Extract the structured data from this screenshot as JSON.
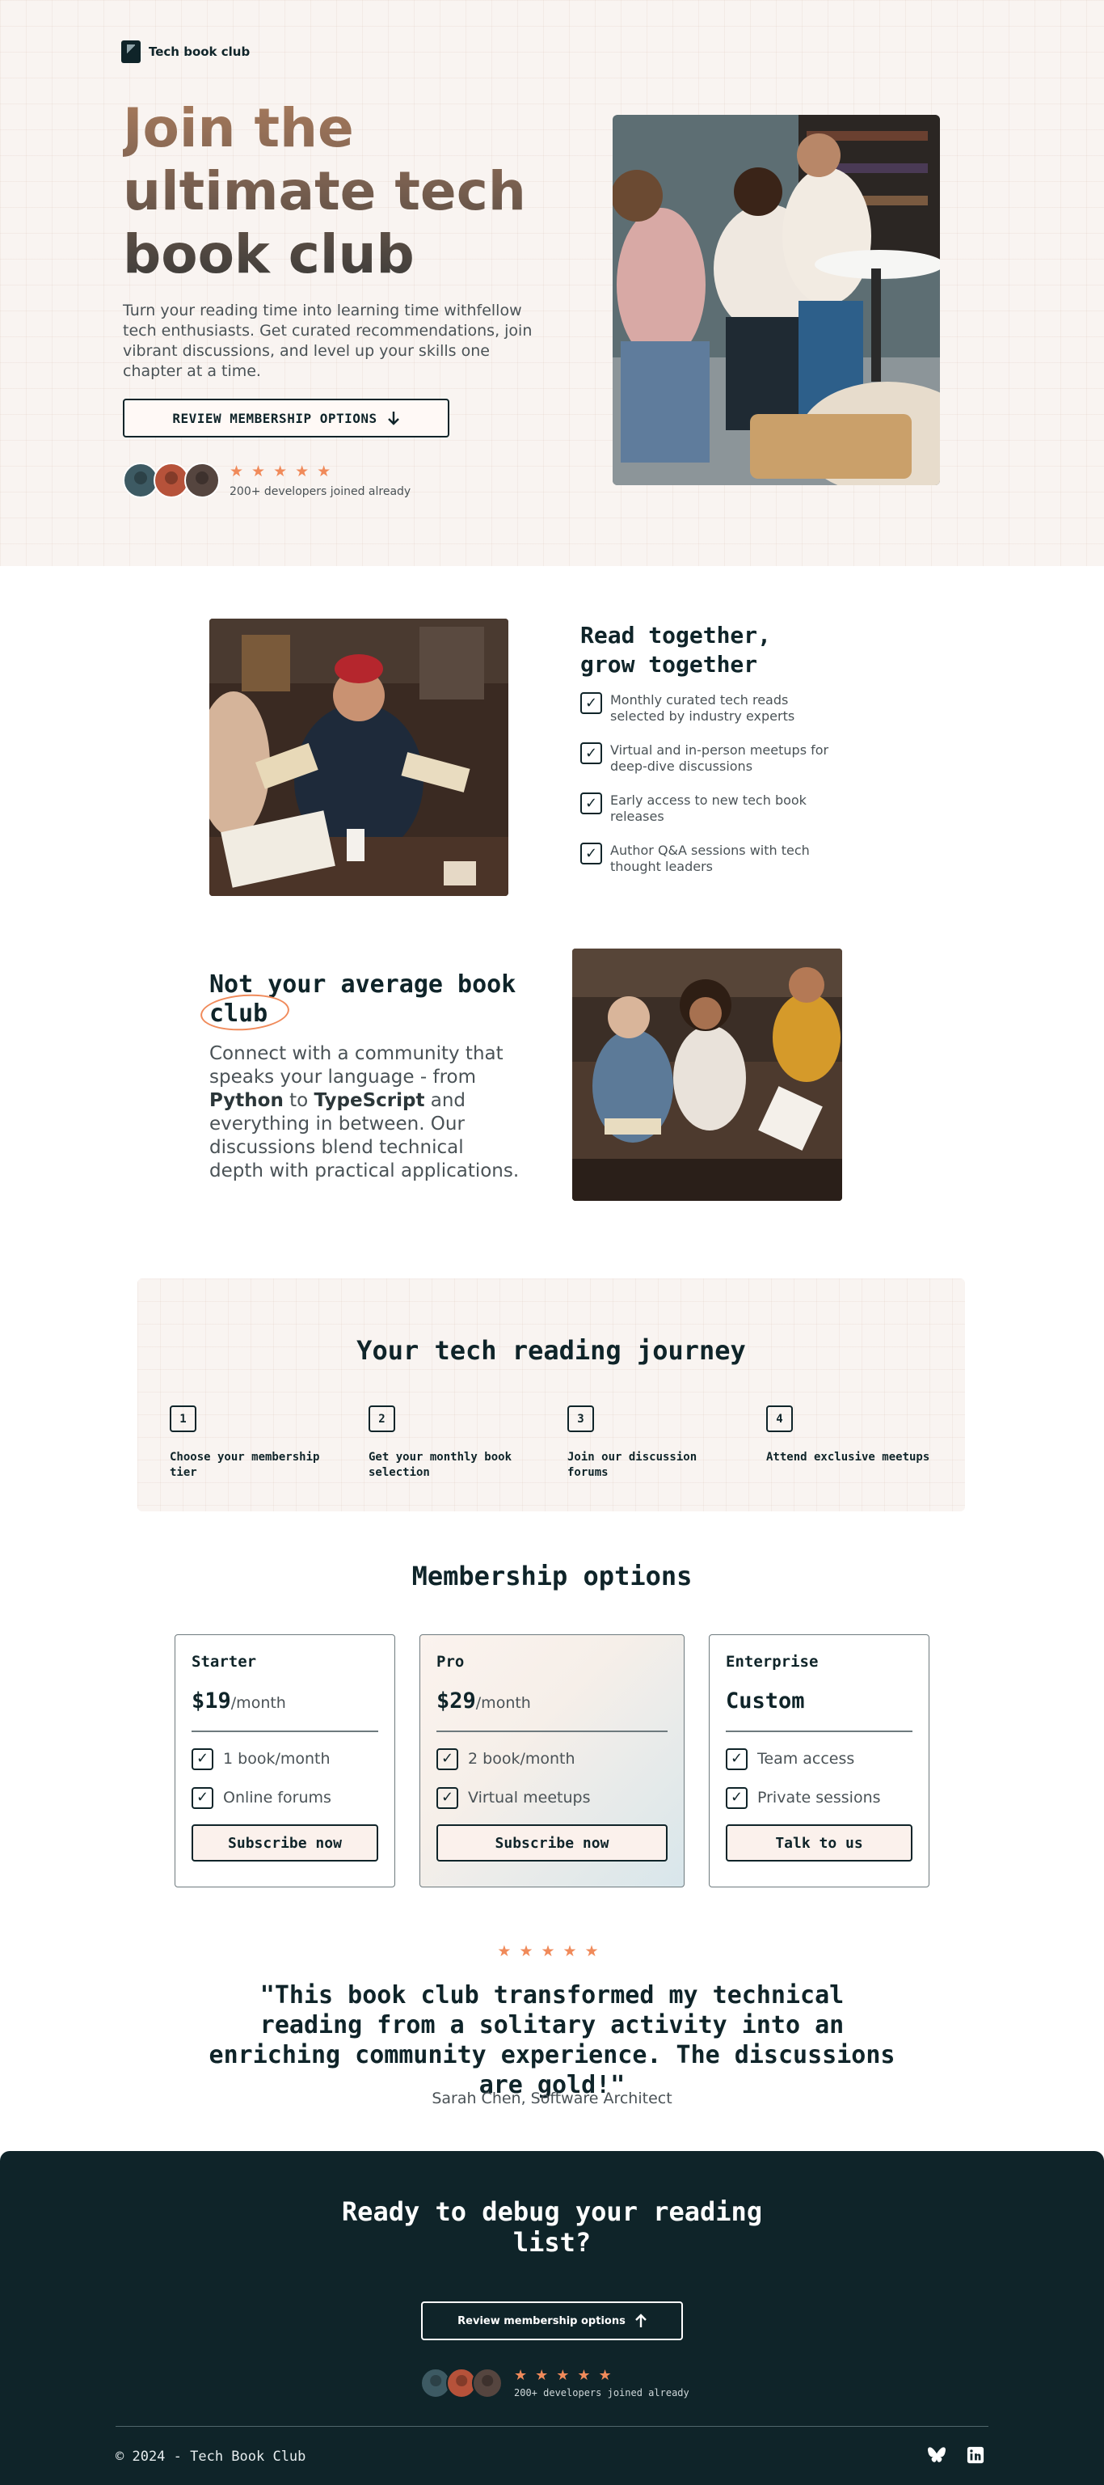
{
  "brand": {
    "name": "Tech book club"
  },
  "hero": {
    "title": "Join the ultimate tech book club",
    "subtitle": "Turn your reading time into learning time withfellow tech enthusiasts. Get curated recommendations, join vibrant discussions, and level up your skills one chapter at a time.",
    "cta_label": "REVIEW MEMBERSHIP OPTIONS",
    "rating_stars": "★★★★★",
    "social_proof": "200+ developers joined already"
  },
  "feature_read": {
    "title": "Read together, grow together",
    "items": [
      "Monthly curated tech reads selected by industry experts",
      "Virtual and in-person meetups for deep-dive discussions",
      "Early access to new tech book releases",
      "Author Q&A sessions with tech thought leaders"
    ]
  },
  "feature_community": {
    "title_lead": "Not your average book",
    "title_highlight": "club",
    "text_1": "Connect with a community that speaks your language - from ",
    "lang_1": "Python",
    "text_2": " to ",
    "lang_2": "TypeScript",
    "text_3": " and everything in between. Our discussions blend technical depth with practical applications."
  },
  "journey": {
    "title": "Your tech reading journey",
    "steps": [
      {
        "num": "1",
        "label": "Choose your membership tier"
      },
      {
        "num": "2",
        "label": "Get your monthly book selection"
      },
      {
        "num": "3",
        "label": "Join our discussion forums"
      },
      {
        "num": "4",
        "label": "Attend exclusive meetups"
      }
    ]
  },
  "membership": {
    "title": "Membership options",
    "plans": [
      {
        "name": "Starter",
        "price": "$19",
        "period": "/month",
        "features": [
          "1 book/month",
          "Online forums"
        ],
        "button": "Subscribe now"
      },
      {
        "name": "Pro",
        "price": "$29",
        "period": "/month",
        "features": [
          "2 book/month",
          "Virtual meetups"
        ],
        "button": "Subscribe now"
      },
      {
        "name": "Enterprise",
        "price": "Custom",
        "period": "",
        "features": [
          "Team access",
          "Private sessions"
        ],
        "button": "Talk to us"
      }
    ]
  },
  "testimonial": {
    "stars": "★★★★★",
    "quote": "\"This book club transformed my technical reading from a solitary activity into an enriching community experience. The discussions are gold!\"",
    "author": "Sarah Chen, Software Architect"
  },
  "cta": {
    "title": "Ready to debug your reading list?",
    "button": "Review membership options",
    "stars": "★★★★★",
    "social_proof": "200+ developers joined already"
  },
  "footer": {
    "copyright": "© 2024 - Tech Book Club",
    "icons": [
      "bluesky-icon",
      "linkedin-icon"
    ]
  },
  "colors": {
    "primary": "#0f2429",
    "accent": "#f08a5a",
    "hero_bg": "#f9f4f1",
    "text_muted": "#4a5256"
  }
}
